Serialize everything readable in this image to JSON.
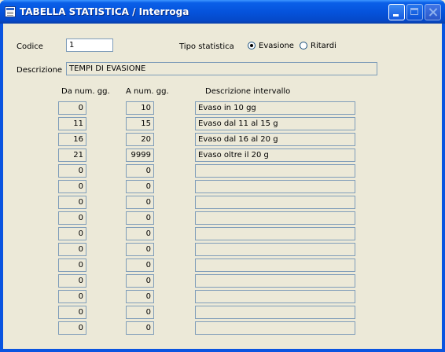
{
  "window": {
    "title": "TABELLA STATISTICA / Interroga"
  },
  "form": {
    "codice_label": "Codice",
    "codice_value": "1",
    "tipo_label": "Tipo statistica",
    "tipo_options": [
      {
        "label": "Evasione",
        "selected": true
      },
      {
        "label": "Ritardi",
        "selected": false
      }
    ],
    "descrizione_label": "Descrizione",
    "descrizione_value": "TEMPI DI EVASIONE"
  },
  "grid": {
    "headers": {
      "da": "Da num. gg.",
      "a": "A num. gg.",
      "desc": "Descrizione intervallo"
    },
    "rows": [
      {
        "da": "0",
        "a": "10",
        "desc": "Evaso in 10 gg"
      },
      {
        "da": "11",
        "a": "15",
        "desc": "Evaso dal 11 al 15 g"
      },
      {
        "da": "16",
        "a": "20",
        "desc": "Evaso dal 16 al 20 g"
      },
      {
        "da": "21",
        "a": "9999",
        "desc": "Evaso oltre il 20 g"
      },
      {
        "da": "0",
        "a": "0",
        "desc": ""
      },
      {
        "da": "0",
        "a": "0",
        "desc": ""
      },
      {
        "da": "0",
        "a": "0",
        "desc": ""
      },
      {
        "da": "0",
        "a": "0",
        "desc": ""
      },
      {
        "da": "0",
        "a": "0",
        "desc": ""
      },
      {
        "da": "0",
        "a": "0",
        "desc": ""
      },
      {
        "da": "0",
        "a": "0",
        "desc": ""
      },
      {
        "da": "0",
        "a": "0",
        "desc": ""
      },
      {
        "da": "0",
        "a": "0",
        "desc": ""
      },
      {
        "da": "0",
        "a": "0",
        "desc": ""
      },
      {
        "da": "0",
        "a": "0",
        "desc": ""
      }
    ]
  }
}
